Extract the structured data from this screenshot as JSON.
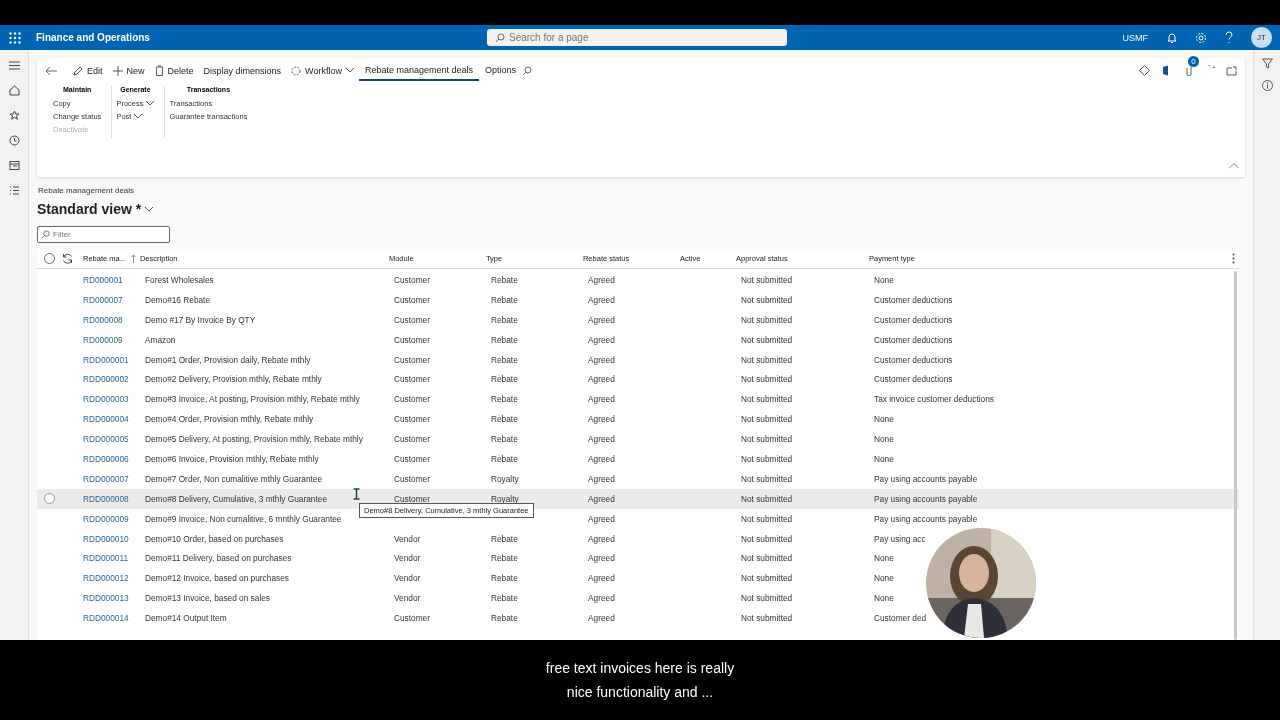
{
  "app": {
    "title": "Finance and Operations",
    "search_placeholder": "Search for a page",
    "company": "USMF",
    "avatar": "JT"
  },
  "action_pane": {
    "items": [
      {
        "kind": "back"
      },
      {
        "kind": "edit",
        "label": "Edit"
      },
      {
        "kind": "new",
        "label": "New"
      },
      {
        "kind": "delete",
        "label": "Delete"
      },
      {
        "kind": "button",
        "label": "Display dimensions"
      },
      {
        "kind": "menu",
        "label": "Workflow"
      },
      {
        "kind": "tab",
        "label": "Rebate management deals",
        "selected": true
      },
      {
        "kind": "tab",
        "label": "Options",
        "selected": false
      },
      {
        "kind": "search"
      }
    ],
    "attachments_count": "0",
    "groups": [
      {
        "title": "Maintain",
        "items": [
          {
            "label": "Copy",
            "disabled": false,
            "dropdown": false
          },
          {
            "label": "Change status",
            "disabled": false,
            "dropdown": false
          },
          {
            "label": "Deactivate",
            "disabled": true,
            "dropdown": false
          }
        ]
      },
      {
        "title": "Generate",
        "items": [
          {
            "label": "Process",
            "disabled": false,
            "dropdown": true
          },
          {
            "label": "Post",
            "disabled": false,
            "dropdown": true
          }
        ]
      },
      {
        "title": "Transactions",
        "items": [
          {
            "label": "Transactions",
            "disabled": false,
            "dropdown": false
          },
          {
            "label": "Guarantee transactions",
            "disabled": false,
            "dropdown": false
          }
        ]
      }
    ]
  },
  "page": {
    "breadcrumb": "Rebate management deals",
    "view": "Standard view *",
    "filter_placeholder": "Filter"
  },
  "table": {
    "select_all": {
      "checked": false
    },
    "columns": [
      "Rebate ma...",
      "Description",
      "Module",
      "Type",
      "Rebate status",
      "Active",
      "Approval status",
      "Payment type"
    ],
    "rows": [
      {
        "id": "RD000001",
        "description": "Forest Wholesales",
        "module": "Customer",
        "type": "Rebate",
        "rebate_status": "Agreed",
        "approval_status": "Not submitted",
        "payment_type": "None",
        "hovered": false
      },
      {
        "id": "RD000007",
        "description": "Demo#16 Rebate",
        "module": "Customer",
        "type": "Rebate",
        "rebate_status": "Agreed",
        "approval_status": "Not submitted",
        "payment_type": "Customer deductions",
        "hovered": false
      },
      {
        "id": "RD000008",
        "description": "Demo #17 By Invoice By QTY",
        "module": "Customer",
        "type": "Rebate",
        "rebate_status": "Agreed",
        "approval_status": "Not submitted",
        "payment_type": "Customer deductions",
        "hovered": false
      },
      {
        "id": "RD000009",
        "description": "Amazon",
        "module": "Customer",
        "type": "Rebate",
        "rebate_status": "Agreed",
        "approval_status": "Not submitted",
        "payment_type": "Customer deductions",
        "hovered": false
      },
      {
        "id": "RDD000001",
        "description": "Demo#1 Order, Provision daily, Rebate mthly",
        "module": "Customer",
        "type": "Rebate",
        "rebate_status": "Agreed",
        "approval_status": "Not submitted",
        "payment_type": "Customer deductions",
        "hovered": false
      },
      {
        "id": "RDD000002",
        "description": "Demo#2 Delivery, Provision mthly, Rebate mthly",
        "module": "Customer",
        "type": "Rebate",
        "rebate_status": "Agreed",
        "approval_status": "Not submitted",
        "payment_type": "Customer deductions",
        "hovered": false
      },
      {
        "id": "RDD000003",
        "description": "Demo#3 Invoice, At posting, Provision mthly, Rebate mthly",
        "module": "Customer",
        "type": "Rebate",
        "rebate_status": "Agreed",
        "approval_status": "Not submitted",
        "payment_type": "Tax invoice customer deductions",
        "hovered": false
      },
      {
        "id": "RDD000004",
        "description": "Demo#4 Order, Provision mthly, Rebate mthly",
        "module": "Customer",
        "type": "Rebate",
        "rebate_status": "Agreed",
        "approval_status": "Not submitted",
        "payment_type": "None",
        "hovered": false
      },
      {
        "id": "RDD000005",
        "description": "Demo#5 Delivery, At posting, Provision mthly, Rebate mthly",
        "module": "Customer",
        "type": "Rebate",
        "rebate_status": "Agreed",
        "approval_status": "Not submitted",
        "payment_type": "None",
        "hovered": false
      },
      {
        "id": "RDD000006",
        "description": "Demo#6 Invoice, Provision mthly, Rebate mthly",
        "module": "Customer",
        "type": "Rebate",
        "rebate_status": "Agreed",
        "approval_status": "Not submitted",
        "payment_type": "None",
        "hovered": false
      },
      {
        "id": "RDD000007",
        "description": "Demo#7 Order, Non cumalitive mthly Guarantee",
        "module": "Customer",
        "type": "Royalty",
        "rebate_status": "Agreed",
        "approval_status": "Not submitted",
        "payment_type": "Pay using accounts payable",
        "hovered": false
      },
      {
        "id": "RDD000008",
        "description": "Demo#8 Delivery, Cumulative, 3 mthly Guarantee",
        "module": "Customer",
        "type": "Royalty",
        "rebate_status": "Agreed",
        "approval_status": "Not submitted",
        "payment_type": "Pay using accounts payable",
        "hovered": true
      },
      {
        "id": "RDD000009",
        "description": "Demo#9 Invoice, Non cumalitive, 6 mnthly Guarantee",
        "rebate_status": "Agreed",
        "approval_status": "Not submitted",
        "payment_type": "Pay using accounts payable",
        "hovered": false
      },
      {
        "id": "RDD000010",
        "description": "Demo#10 Order, based on purchases",
        "module": "Vendor",
        "type": "Rebate",
        "rebate_status": "Agreed",
        "approval_status": "Not submitted",
        "payment_type": "Pay using acc",
        "hovered": false
      },
      {
        "id": "RDD000011",
        "description": "Demo#11 Delivery, based on purchases",
        "module": "Vendor",
        "type": "Rebate",
        "rebate_status": "Agreed",
        "approval_status": "Not submitted",
        "payment_type": "None",
        "hovered": false
      },
      {
        "id": "RDD000012",
        "description": "Demo#12 Invoice, based on purchases",
        "module": "Vendor",
        "type": "Rebate",
        "rebate_status": "Agreed",
        "approval_status": "Not submitted",
        "payment_type": "None",
        "hovered": false
      },
      {
        "id": "RDD000013",
        "description": "Demo#13 Invoice, based on sales",
        "module": "Vendor",
        "type": "Rebate",
        "rebate_status": "Agreed",
        "approval_status": "Not submitted",
        "payment_type": "None",
        "hovered": false
      },
      {
        "id": "RDD000014",
        "description": "Demo#14 Output Item",
        "module": "Customer",
        "type": "Rebate",
        "rebate_status": "Agreed",
        "approval_status": "Not submitted",
        "payment_type": "Customer ded",
        "hovered": false
      }
    ],
    "tooltip": "Demo#8 Delivery, Cumulative, 3 mthly Guarantee"
  },
  "webcam": {
    "kind": "picture"
  },
  "captions": [
    "free text invoices here is really",
    "nice functionality and ..."
  ]
}
